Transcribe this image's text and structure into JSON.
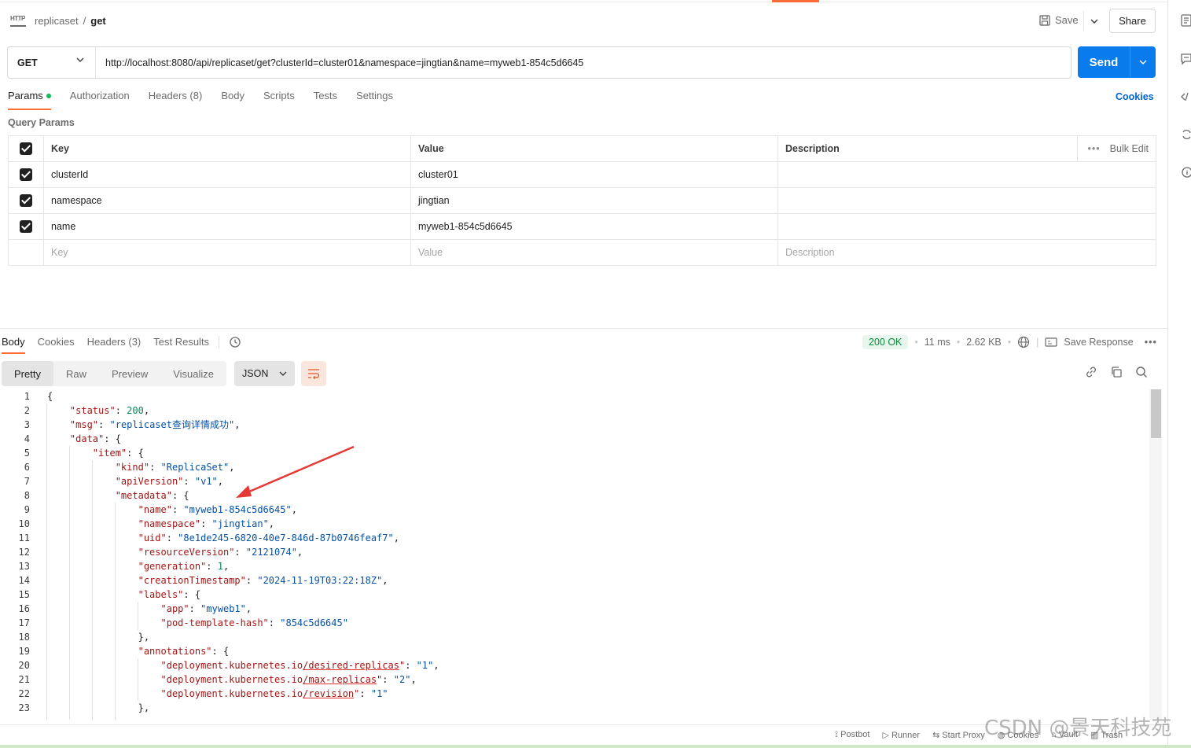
{
  "breadcrumb": {
    "parent": "replicaset",
    "separator": "/",
    "current": "get"
  },
  "header": {
    "save_label": "Save",
    "share_label": "Share"
  },
  "request": {
    "method": "GET",
    "url": "http://localhost:8080/api/replicaset/get?clusterId=cluster01&namespace=jingtian&name=myweb1-854c5d6645",
    "send_label": "Send"
  },
  "request_tabs": {
    "params": "Params",
    "authorization": "Authorization",
    "headers": "Headers (8)",
    "body": "Body",
    "scripts": "Scripts",
    "tests": "Tests",
    "settings": "Settings",
    "cookies": "Cookies"
  },
  "query_params": {
    "title": "Query Params",
    "headers": {
      "key": "Key",
      "value": "Value",
      "description": "Description",
      "bulk_edit": "Bulk Edit"
    },
    "rows": [
      {
        "key": "clusterId",
        "value": "cluster01",
        "description": ""
      },
      {
        "key": "namespace",
        "value": "jingtian",
        "description": ""
      },
      {
        "key": "name",
        "value": "myweb1-854c5d6645",
        "description": ""
      }
    ],
    "placeholders": {
      "key": "Key",
      "value": "Value",
      "description": "Description"
    }
  },
  "response_tabs": {
    "body": "Body",
    "cookies": "Cookies",
    "headers": "Headers (3)",
    "test_results": "Test Results"
  },
  "response_meta": {
    "status": "200 OK",
    "time": "11 ms",
    "size": "2.62 KB",
    "save_response": "Save Response"
  },
  "view_modes": {
    "pretty": "Pretty",
    "raw": "Raw",
    "preview": "Preview",
    "visualize": "Visualize",
    "format": "JSON"
  },
  "code_lines": [
    "1",
    "2",
    "3",
    "4",
    "5",
    "6",
    "7",
    "8",
    "9",
    "10",
    "11",
    "12",
    "13",
    "14",
    "15",
    "16",
    "17",
    "18",
    "19",
    "20",
    "21",
    "22",
    "23"
  ],
  "json_values": {
    "status": "200",
    "msg": "replicaset查询详情成功",
    "kind": "ReplicaSet",
    "apiVersion": "v1",
    "name": "myweb1-854c5d6645",
    "namespace": "jingtian",
    "uid": "8e1de245-6820-40e7-846d-87b0746feaf7",
    "resourceVersion": "2121074",
    "generation": "1",
    "creationTimestamp": "2024-11-19T03:22:18Z",
    "app": "myweb1",
    "pod_template_hash": "854c5d6645",
    "desired_replicas": "1",
    "max_replicas": "2",
    "revision": "1"
  },
  "status_bar": {
    "postbot": "Postbot",
    "runner": "Runner",
    "start_proxy": "Start Proxy",
    "cookies": "Cookies",
    "vault": "Vault",
    "trash": "Trash"
  },
  "watermark": "CSDN @景天科技苑",
  "colors": {
    "accent": "#ff6c37",
    "send": "#097bed",
    "link": "#0265d2",
    "ok": "#0a8a3c"
  }
}
